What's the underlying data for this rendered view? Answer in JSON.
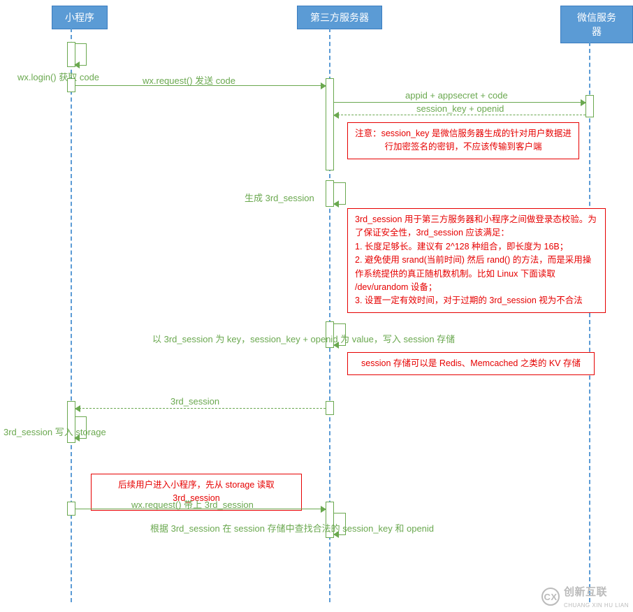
{
  "participants": {
    "miniprogram": "小程序",
    "thirdparty": "第三方服务器",
    "wechat": "微信服务器"
  },
  "messages": {
    "login": "wx.login() 获取 code",
    "request_code": "wx.request() 发送 code",
    "to_wechat": "appid + appsecret + code",
    "from_wechat": "session_key + openid",
    "gen_session": "生成 3rd_session",
    "write_session": "以 3rd_session 为 key，session_key + openid 为 value，写入 session 存储",
    "return_session": "3rd_session",
    "write_storage": "3rd_session 写入 storage",
    "request_with_session": "wx.request() 带上 3rd_session",
    "lookup": "根据 3rd_session 在 session 存储中查找合法的 session_key 和 openid"
  },
  "notes": {
    "warn_sessionkey": "注意：session_key 是微信服务器生成的针对用户数据进行加密签名的密钥，不应该传输到客户端",
    "rules_l1": "3rd_session 用于第三方服务器和小程序之间做登录态校验。为了保证安全性，3rd_session 应该满足：",
    "rules_l2": "1. 长度足够长。建议有 2^128 种组合，即长度为 16B；",
    "rules_l3": "2. 避免使用 srand(当前时间) 然后 rand() 的方法，而是采用操作系统提供的真正随机数机制。比如 Linux 下面读取 /dev/urandom 设备；",
    "rules_l4": "3. 设置一定有效时间，对于过期的 3rd_session 视为不合法",
    "kv_store": "session 存储可以是 Redis、Memcached 之类的 KV 存储",
    "storage_read": "后续用户进入小程序，先从 storage 读取 3rd_session"
  },
  "watermark": {
    "text": "创新互联",
    "sub": "CHUANG XIN HU LIAN",
    "logo": "CX"
  }
}
